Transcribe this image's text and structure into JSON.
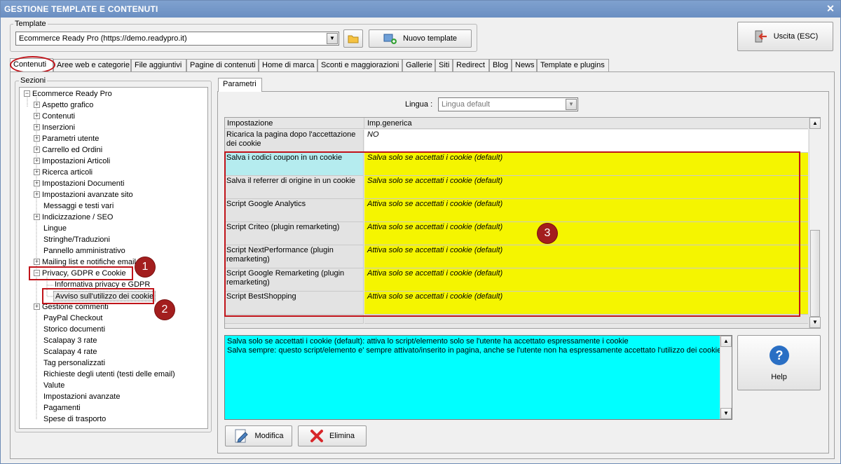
{
  "window": {
    "title": "GESTIONE TEMPLATE E CONTENUTI",
    "close": "✕"
  },
  "template": {
    "group_label": "Template",
    "selected": "Ecommerce Ready Pro (https://demo.readypro.it)",
    "new_button": "Nuovo template",
    "exit_button": "Uscita (ESC)"
  },
  "tabs": [
    "Contenuti",
    "Aree web e categorie",
    "File aggiuntivi",
    "Pagine di contenuti",
    "Home di marca",
    "Sconti e maggiorazioni",
    "Gallerie",
    "Siti",
    "Redirect",
    "Blog",
    "News",
    "Template e plugins"
  ],
  "sections": {
    "label": "Sezioni",
    "root": "Ecommerce Ready Pro",
    "items": [
      {
        "label": "Aspetto grafico",
        "expandable": true
      },
      {
        "label": "Contenuti",
        "expandable": true
      },
      {
        "label": "Inserzioni",
        "expandable": true
      },
      {
        "label": "Parametri utente",
        "expandable": true
      },
      {
        "label": "Carrello ed Ordini",
        "expandable": true
      },
      {
        "label": "Impostazioni Articoli",
        "expandable": true
      },
      {
        "label": "Ricerca articoli",
        "expandable": true
      },
      {
        "label": "Impostazioni Documenti",
        "expandable": true
      },
      {
        "label": "Impostazioni avanzate sito",
        "expandable": true
      },
      {
        "label": "Messaggi e testi vari",
        "expandable": false
      },
      {
        "label": "Indicizzazione / SEO",
        "expandable": true
      },
      {
        "label": "Lingue",
        "expandable": false
      },
      {
        "label": "Stringhe/Traduzioni",
        "expandable": false
      },
      {
        "label": "Pannello amministrativo",
        "expandable": false
      },
      {
        "label": "Mailing list e notifiche email",
        "expandable": true
      },
      {
        "label": "Privacy, GDPR e Cookie",
        "expandable": true,
        "expanded": true
      },
      {
        "label": "Informativa privacy e GDPR",
        "child": true
      },
      {
        "label": "Avviso sull'utilizzo dei cookie",
        "child": true,
        "selected": true
      },
      {
        "label": "Gestione commenti",
        "expandable": true
      },
      {
        "label": "PayPal Checkout",
        "expandable": false
      },
      {
        "label": "Storico documenti",
        "expandable": false
      },
      {
        "label": "Scalapay 3 rate",
        "expandable": false
      },
      {
        "label": "Scalapay 4 rate",
        "expandable": false
      },
      {
        "label": "Tag personalizzati",
        "expandable": false
      },
      {
        "label": "Richieste degli utenti (testi delle email)",
        "expandable": false
      },
      {
        "label": "Valute",
        "expandable": false
      },
      {
        "label": "Impostazioni avanzate",
        "expandable": false
      },
      {
        "label": "Pagamenti",
        "expandable": false
      },
      {
        "label": "Spese di trasporto",
        "expandable": false
      }
    ]
  },
  "params": {
    "tab": "Parametri",
    "language_label": "Lingua :",
    "language_value": "Lingua default",
    "col_setting": "Impostazione",
    "col_value": "Imp.generica",
    "rows": [
      {
        "setting": "Ricarica la pagina dopo l'accettazione dei cookie",
        "value": "NO",
        "highlight": false
      },
      {
        "setting": "Salva i codici coupon in un cookie",
        "value": "Salva solo se accettati i cookie (default)",
        "highlight": true,
        "selected": true
      },
      {
        "setting": "Salva il referrer di origine in un cookie",
        "value": "Salva solo se accettati i cookie (default)",
        "highlight": true
      },
      {
        "setting": "Script Google Analytics",
        "value": "Attiva solo se accettati i cookie (default)",
        "highlight": true
      },
      {
        "setting": "Script Criteo (plugin remarketing)",
        "value": "Attiva solo se accettati i cookie (default)",
        "highlight": true
      },
      {
        "setting": "Script NextPerformance (plugin remarketing)",
        "value": "Attiva solo se accettati i cookie (default)",
        "highlight": true
      },
      {
        "setting": "Script Google Remarketing (plugin remarketing)",
        "value": "Attiva solo se accettati i cookie (default)",
        "highlight": true
      },
      {
        "setting": "Script BestShopping",
        "value": "Attiva solo se accettati i cookie (default)",
        "highlight": true
      }
    ],
    "description": [
      "Salva solo se accettati i cookie (default): attiva lo script/elemento solo se l'utente ha accettato espressamente i cookie",
      "Salva sempre: questo script/elemento e' sempre attivato/inserito in pagina, anche se l'utente non ha espressamente accettato l'utilizzo dei cookie"
    ],
    "help_button": "Help",
    "edit_button": "Modifica",
    "delete_button": "Elimina"
  },
  "markers": [
    "1",
    "2",
    "3"
  ],
  "colors": {
    "highlight": "#f5f500",
    "selected_cell": "#b5ecef",
    "description_bg": "#00ffff",
    "annotation": "#c0141a"
  }
}
